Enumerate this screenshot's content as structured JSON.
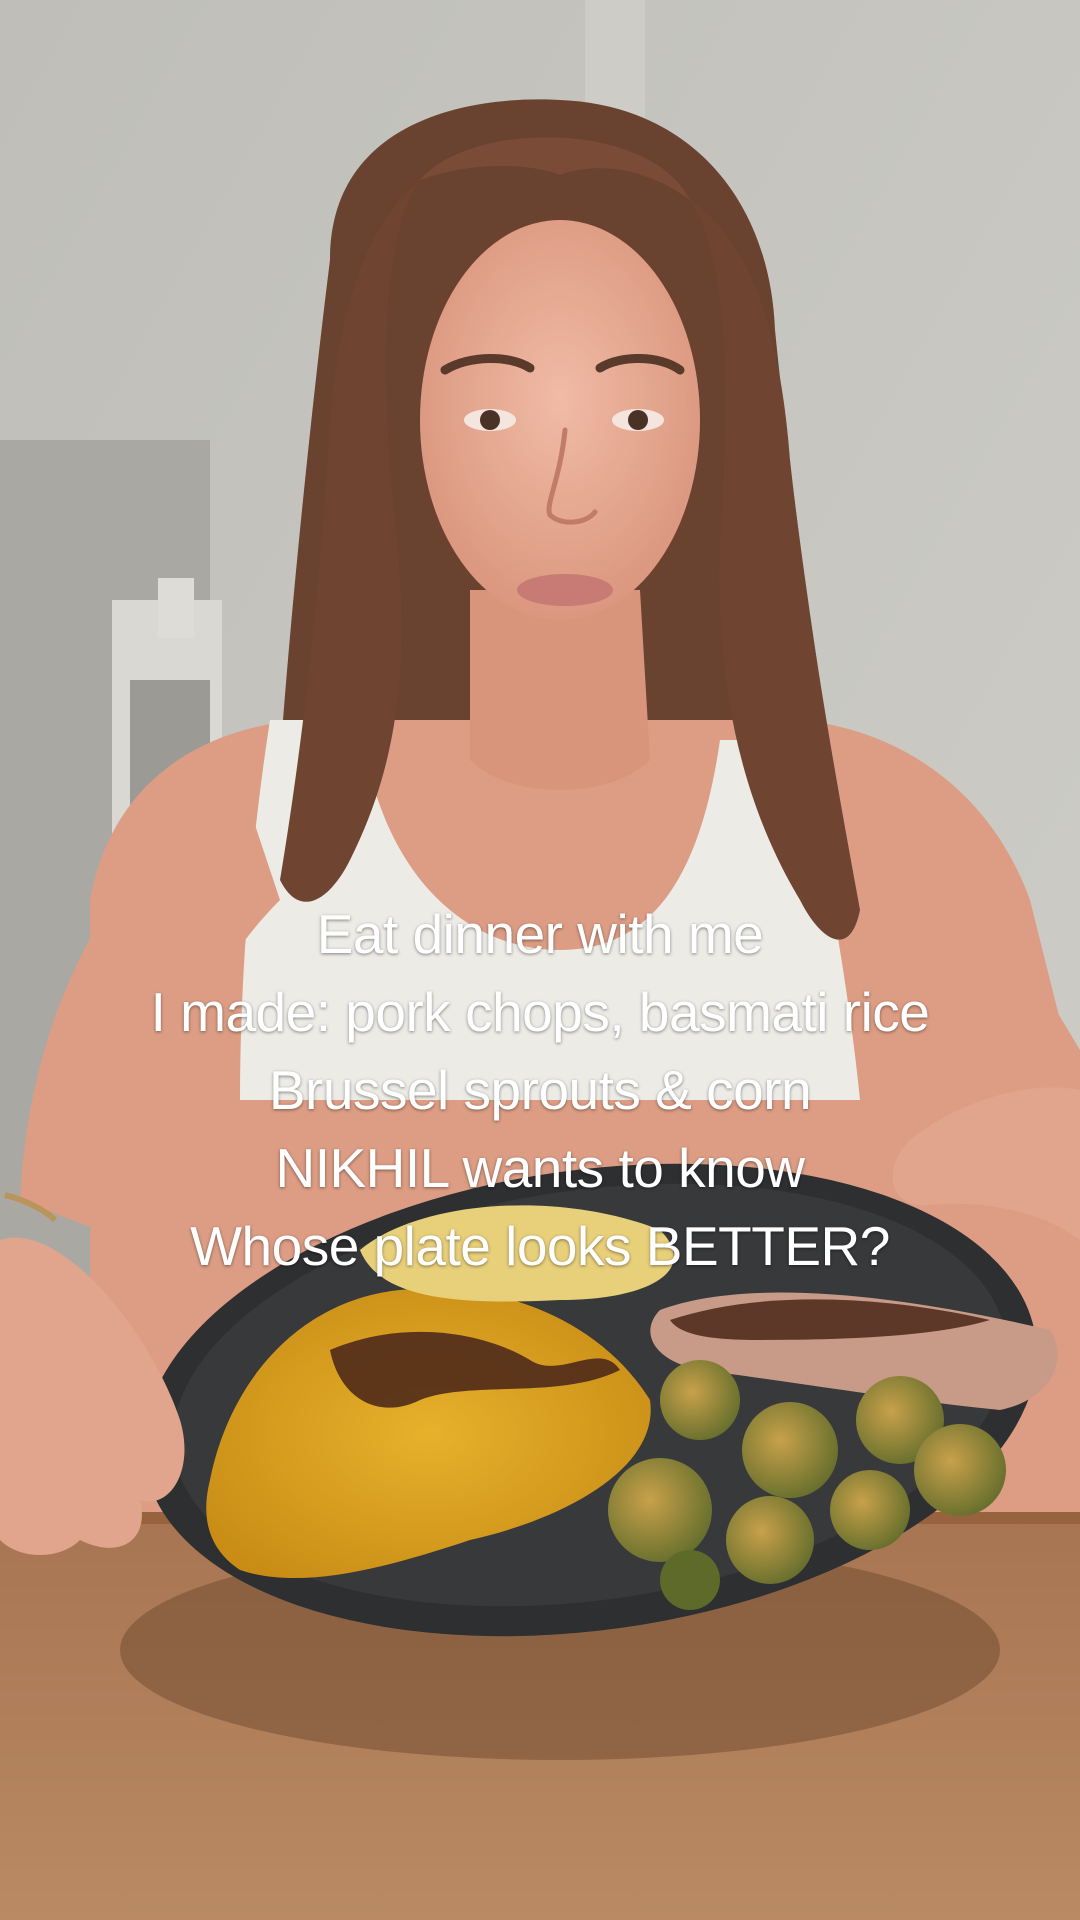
{
  "caption": {
    "lines": [
      "Eat dinner with me",
      "I made: pork chops, basmati rice",
      "Brussel sprouts & corn",
      "NIKHIL wants to know",
      "Whose plate looks BETTER?"
    ]
  },
  "scene": {
    "wall_color": "#c3c2bc",
    "table_color": "#b07a52",
    "plate_color": "#2e2f31",
    "rice_color": "#d9a321",
    "hair_color": "#6a4230",
    "skin_color": "#e2a48c",
    "top_color": "#ecebe6"
  }
}
